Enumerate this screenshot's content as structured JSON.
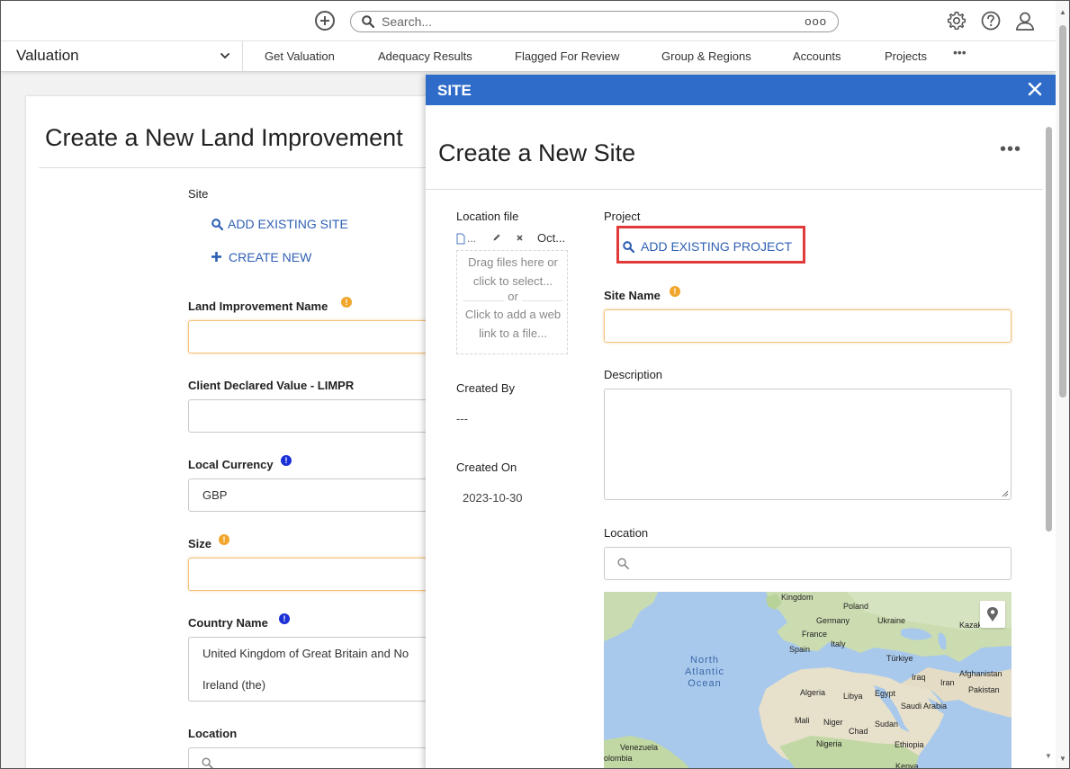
{
  "topbar": {
    "search_placeholder": "Search...",
    "search_options": "ooo"
  },
  "navbar": {
    "app_title": "Valuation",
    "items": [
      "Get Valuation",
      "Adequacy Results",
      "Flagged For Review",
      "Group & Regions",
      "Accounts",
      "Projects"
    ],
    "more": "•••"
  },
  "background_form": {
    "title": "Create a New Land Improvement",
    "site_label": "Site",
    "add_existing_site": "ADD EXISTING SITE",
    "create_new": "CREATE NEW",
    "land_improvement_name_label": "Land Improvement Name",
    "client_declared_value_label": "Client Declared Value - LIMPR",
    "local_currency_label": "Local Currency",
    "local_currency_value": "GBP",
    "size_label": "Size",
    "country_name_label": "Country Name",
    "country_name_line1": "United Kingdom of Great Britain and No",
    "country_name_line2": "Ireland (the)",
    "location_label": "Location"
  },
  "panel": {
    "header": "SITE",
    "title": "Create a New Site",
    "more": "•••",
    "location_file_label": "Location file",
    "file_name": "...",
    "file_date": "Oct...",
    "dropzone_line1": "Drag files here or",
    "dropzone_line2": "click to select...",
    "dropzone_or": "or",
    "dropzone_line3": "Click to add a web",
    "dropzone_line4": "link to a file...",
    "created_by_label": "Created By",
    "created_by_value": "---",
    "created_on_label": "Created On",
    "created_on_value": "2023-10-30",
    "project_label": "Project",
    "add_existing_project": "ADD EXISTING PROJECT",
    "site_name_label": "Site Name",
    "description_label": "Description",
    "location_label": "Location",
    "map": {
      "labels": [
        "Kingdom",
        "Poland",
        "Germany",
        "Ukraine",
        "France",
        "Kazak",
        "Spain",
        "Italy",
        "Türkiye",
        "Afghanistan",
        "Iraq",
        "Iran",
        "Pakistan",
        "Algeria",
        "Libya",
        "Egypt",
        "Saudi Arabia",
        "Mali",
        "Niger",
        "Chad",
        "Sudan",
        "Nigeria",
        "Ethiopia",
        "Kenya",
        "Venezuela",
        "olombia"
      ],
      "ocean": [
        "North",
        "Atlantic",
        "Ocean"
      ]
    }
  },
  "colors": {
    "panel_header": "#2f6cc9",
    "link": "#2f5fb3",
    "highlight": "#e03a3a",
    "required_warning": "#f0a62a",
    "info": "#1a2fd6"
  }
}
